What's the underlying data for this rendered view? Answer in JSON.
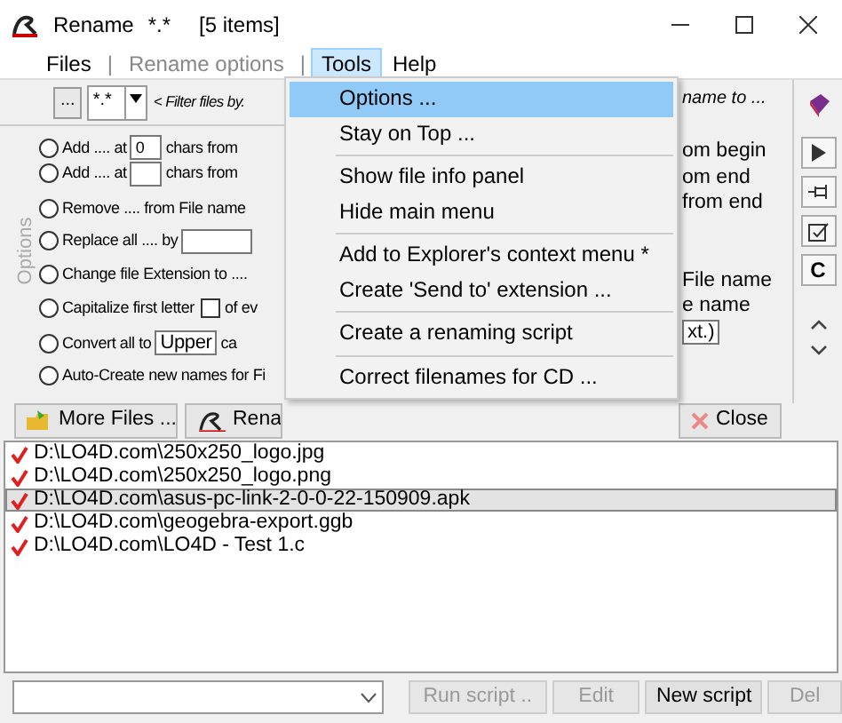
{
  "window": {
    "title": "Rename",
    "mask": "*.*",
    "count": "[5 items]"
  },
  "menu_bar": [
    {
      "kind": "item",
      "label": "Files",
      "selected": false,
      "disabled": false
    },
    {
      "kind": "separator",
      "label": "|"
    },
    {
      "kind": "item",
      "label": "Rename options",
      "selected": false,
      "disabled": true
    },
    {
      "kind": "separator",
      "label": "|"
    },
    {
      "kind": "item",
      "label": "Tools",
      "selected": true,
      "disabled": false
    },
    {
      "kind": "item",
      "label": "Help",
      "selected": false,
      "disabled": false
    }
  ],
  "tools_menu": [
    {
      "kind": "item",
      "label": "Options ...",
      "selected": true
    },
    {
      "kind": "item",
      "label": "Stay on Top ...",
      "selected": false
    },
    {
      "kind": "separator"
    },
    {
      "kind": "item",
      "label": "Show file info panel",
      "selected": false
    },
    {
      "kind": "item",
      "label": "Hide main menu",
      "selected": false
    },
    {
      "kind": "separator"
    },
    {
      "kind": "item",
      "label": "Add to Explorer's context menu *",
      "selected": false
    },
    {
      "kind": "item",
      "label": "Create 'Send to' extension ...",
      "selected": false
    },
    {
      "kind": "separator"
    },
    {
      "kind": "item",
      "label": "Create a renaming script",
      "selected": false
    },
    {
      "kind": "separator"
    },
    {
      "kind": "item",
      "label": "Correct filenames for CD ...",
      "selected": false
    }
  ],
  "filter_bar": {
    "browse": "...",
    "mask": "*.*",
    "hint": "< Filter files by.",
    "right_hint": "name to ..."
  },
  "side_label": "Options",
  "options": [
    {
      "kind": "spin",
      "label": "Add .... at",
      "value": "0",
      "after": "chars from",
      "selected": false
    },
    {
      "kind": "spin",
      "label": "Add .... at",
      "after": "chars from",
      "selected": false
    },
    {
      "kind": "plain",
      "label": "Remove .... from File name",
      "selected": false
    },
    {
      "kind": "field",
      "label": "Replace all .... by",
      "selected": false
    },
    {
      "kind": "plain",
      "label": "Change file Extension to ....",
      "selected": false
    },
    {
      "kind": "check",
      "label": "Capitalize first letter",
      "checked": false,
      "after": "of ev",
      "selected": false
    },
    {
      "kind": "combo",
      "label": "Convert all to",
      "value": "Upper",
      "after": "ca",
      "selected": false
    },
    {
      "kind": "plain",
      "label": "Auto-Create new names for Fi",
      "selected": false
    }
  ],
  "options_right": [
    {
      "kind": "text",
      "label": "om begin"
    },
    {
      "kind": "text",
      "label": "om  end"
    },
    {
      "kind": "text",
      "label": "from end"
    },
    {
      "kind": "gap"
    },
    {
      "kind": "gap"
    },
    {
      "kind": "text",
      "label": "File name"
    },
    {
      "kind": "text",
      "label": "e name"
    },
    {
      "kind": "combo",
      "label": "xt.)"
    }
  ],
  "toolbar_letter": "C",
  "buttons": [
    {
      "kind": "more",
      "label": "More Files ..."
    },
    {
      "kind": "rename",
      "label": "Rena"
    },
    {
      "kind": "close",
      "label": "Close"
    }
  ],
  "files": [
    {
      "path": "D:\\LO4D.com\\250x250_logo.jpg",
      "checked": true,
      "selected": false
    },
    {
      "path": "D:\\LO4D.com\\250x250_logo.png",
      "checked": true,
      "selected": false
    },
    {
      "path": "D:\\LO4D.com\\asus-pc-link-2-0-0-22-150909.apk",
      "checked": true,
      "selected": true
    },
    {
      "path": "D:\\LO4D.com\\geogebra-export.ggb",
      "checked": true,
      "selected": false
    },
    {
      "path": "D:\\LO4D.com\\LO4D - Test 1.c",
      "checked": true,
      "selected": false
    }
  ],
  "script_bar": {
    "buttons": [
      {
        "label": "Run script ..",
        "disabled": true
      },
      {
        "label": "Edit",
        "disabled": true
      },
      {
        "label": "New script",
        "disabled": false
      },
      {
        "label": "Del",
        "disabled": true
      }
    ]
  }
}
